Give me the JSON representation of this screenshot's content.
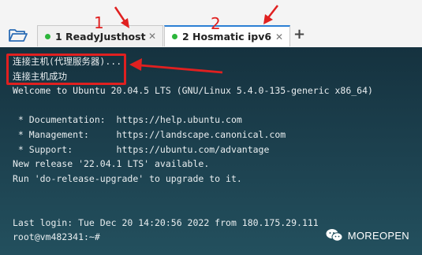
{
  "tabs": [
    {
      "index": "1",
      "name": "ReadyJusthost",
      "status_color": "#2cb63b",
      "active": false,
      "close_icon": "close-icon"
    },
    {
      "index": "2",
      "name": "Hosmatic ipv6",
      "status_color": "#2cb63b",
      "active": true,
      "close_icon": "close-icon"
    }
  ],
  "tab_labels": [
    "1 ReadyJusthost",
    "2 Hosmatic ipv6"
  ],
  "toolbar": {
    "open_icon": "folder-open-icon",
    "add_tab": "+"
  },
  "annotations": {
    "marker_1": "1",
    "marker_2": "2",
    "color": "#e02020"
  },
  "terminal": {
    "lines": [
      "连接主机(代理服务器)...",
      "连接主机成功",
      "Welcome to Ubuntu 20.04.5 LTS (GNU/Linux 5.4.0-135-generic x86_64)",
      "",
      " * Documentation:  https://help.ubuntu.com",
      " * Management:     https://landscape.canonical.com",
      " * Support:        https://ubuntu.com/advantage",
      "New release '22.04.1 LTS' available.",
      "Run 'do-release-upgrade' to upgrade to it.",
      "",
      "",
      "Last login: Tue Dec 20 14:20:56 2022 from 180.175.29.111",
      "root@vm482341:~# "
    ]
  },
  "watermark": {
    "icon": "wechat-icon",
    "text": "MOREOPEN"
  }
}
